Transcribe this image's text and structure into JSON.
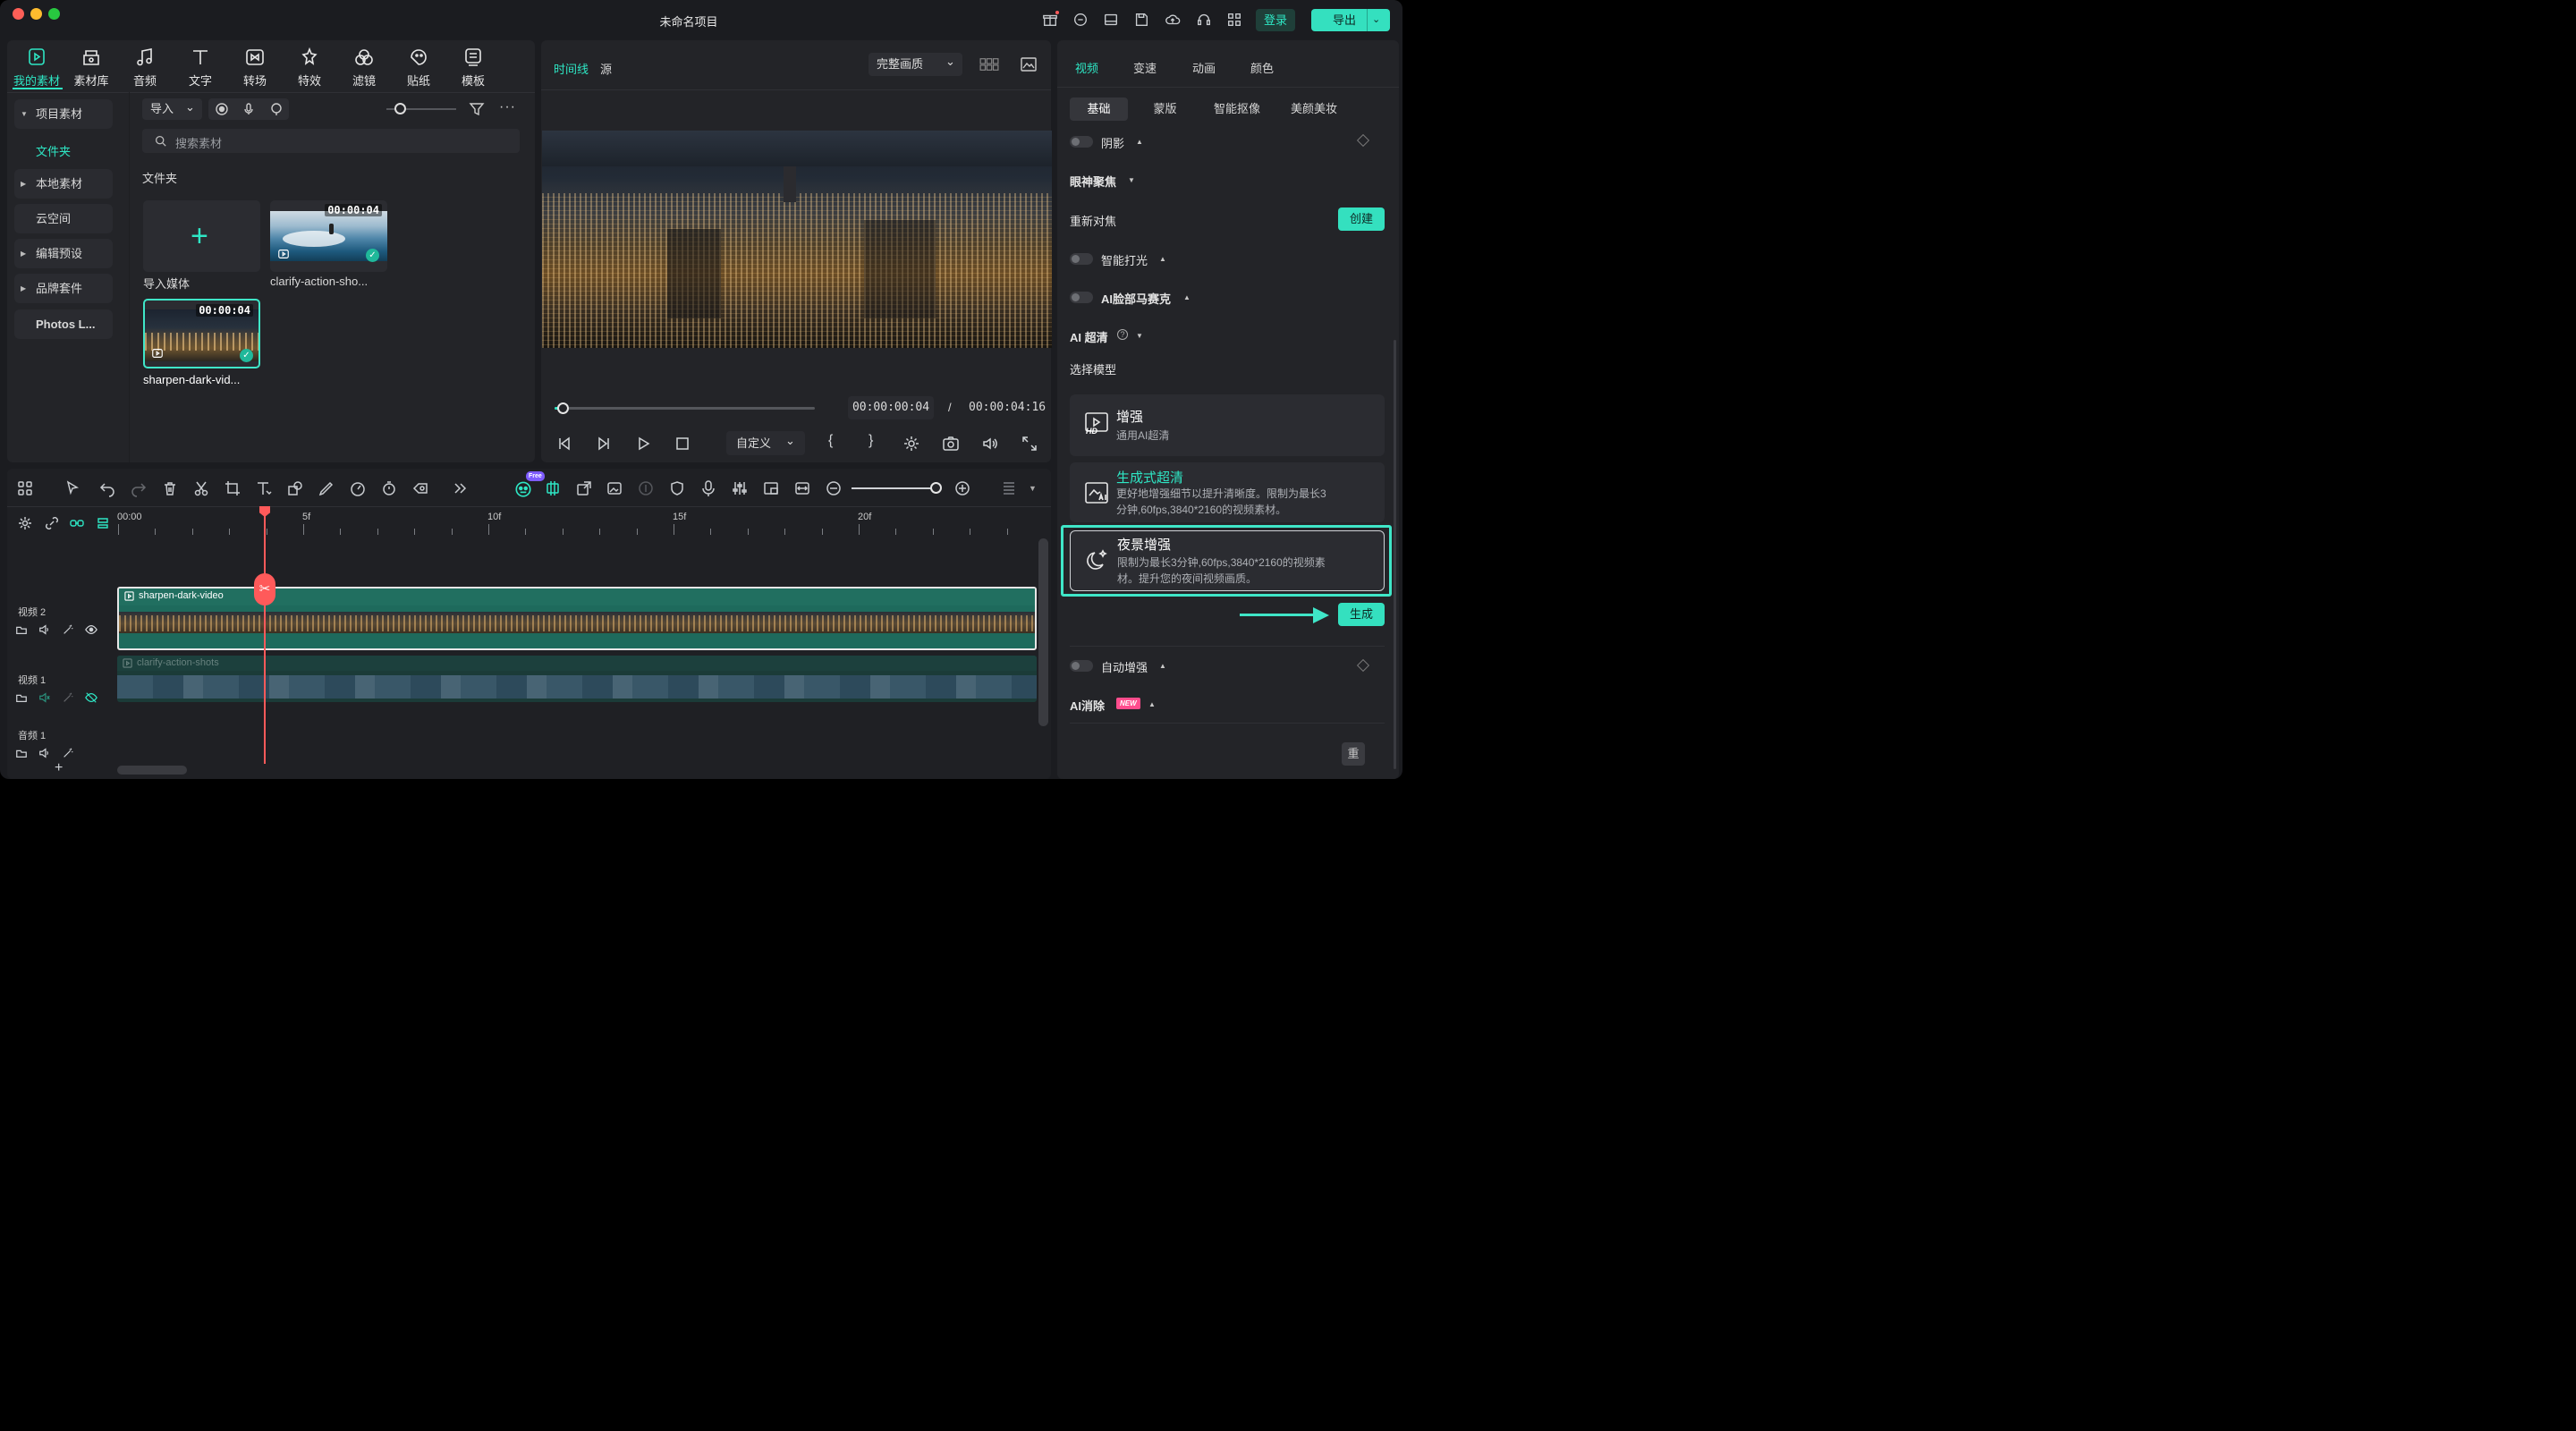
{
  "app": {
    "title": "未命名项目",
    "login": "登录",
    "export": "导出"
  },
  "toolbar": {
    "tools": [
      {
        "label": "我的素材",
        "icon": "my-media-icon"
      },
      {
        "label": "素材库",
        "icon": "stock-media-icon"
      },
      {
        "label": "音频",
        "icon": "audio-icon"
      },
      {
        "label": "文字",
        "icon": "text-icon"
      },
      {
        "label": "转场",
        "icon": "transition-icon"
      },
      {
        "label": "特效",
        "icon": "effects-icon"
      },
      {
        "label": "滤镜",
        "icon": "filter-icon"
      },
      {
        "label": "贴纸",
        "icon": "sticker-icon"
      },
      {
        "label": "模板",
        "icon": "template-icon"
      }
    ]
  },
  "sidebar": {
    "items": [
      "项目素材",
      "文件夹",
      "本地素材",
      "云空间",
      "编辑预设",
      "品牌套件",
      "Photos L..."
    ]
  },
  "media": {
    "import": "导入",
    "search_placeholder": "搜索素材",
    "folder_title": "文件夹",
    "import_media": "导入媒体",
    "clips": [
      {
        "name": "clarify-action-sho...",
        "duration": "00:00:04"
      },
      {
        "name": "sharpen-dark-vid...",
        "duration": "00:00:04"
      }
    ]
  },
  "player": {
    "tab_timeline": "时间线",
    "tab_source": "源",
    "quality": "完整画质",
    "current_time": "00:00:00:04",
    "separator": "/",
    "total_time": "00:00:04:16",
    "custom": "自定义",
    "progress": 0.03
  },
  "right": {
    "tabs": [
      "视频",
      "变速",
      "动画",
      "颜色"
    ],
    "subtabs": [
      "基础",
      "蒙版",
      "智能抠像",
      "美颜美妆"
    ],
    "shadow": "阴影",
    "eye_focus": "眼神聚焦",
    "refocus": "重新对焦",
    "create": "创建",
    "smart_light": "智能打光",
    "ai_face_mosaic": "AI脸部马赛克",
    "ai_upscale": "AI 超清",
    "choose_model": "选择模型",
    "models": [
      {
        "title": "增强",
        "desc": "通用AI超清",
        "icon": "hd-icon"
      },
      {
        "title": "生成式超清",
        "desc": "更好地增强细节以提升清晰度。限制为最长3分钟,60fps,3840*2160的视频素材。",
        "icon": "ai-image-icon"
      },
      {
        "title": "夜景增强",
        "desc": "限制为最长3分钟,60fps,3840*2160的视频素材。提升您的夜间视频画质。",
        "icon": "night-icon"
      }
    ],
    "generate": "生成",
    "auto_enhance": "自动增强",
    "ai_remove": "AI消除",
    "new_badge": "NEW",
    "reset": "重"
  },
  "timeline": {
    "free_badge": "Free",
    "ruler": [
      "00:00",
      "5f",
      "10f",
      "15f",
      "20f"
    ],
    "tracks": [
      {
        "label": "视频 2",
        "clip": "sharpen-dark-video"
      },
      {
        "label": "视频 1",
        "clip": "clarify-action-shots"
      },
      {
        "label": "音频 1",
        "clip": ""
      }
    ],
    "zoom": 0.8
  },
  "colors": {
    "accent": "#2ee6c4",
    "playhead": "#ff5a5a",
    "highlight": "#3fe6c8"
  }
}
